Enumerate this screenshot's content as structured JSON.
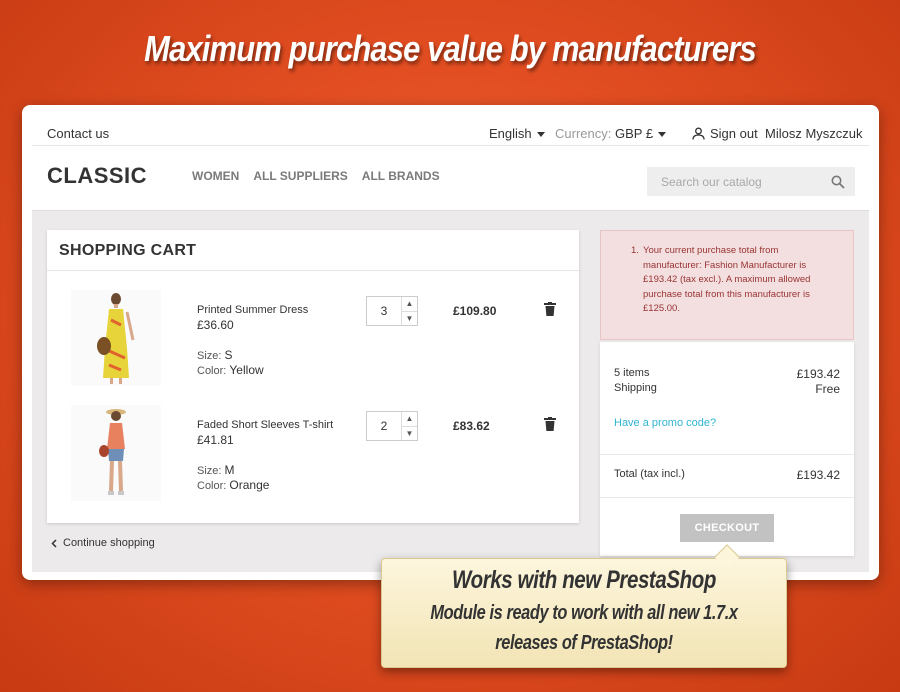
{
  "banner": {
    "title": "Maximum purchase value by manufacturers"
  },
  "topnav": {
    "contact": "Contact us",
    "language": "English",
    "currency_label": "Currency:",
    "currency_value": "GBP £",
    "sign_in": "Sign out",
    "user_name": "Milosz Myszczuk"
  },
  "header": {
    "logo": "CLASSIC",
    "nav": [
      "WOMEN",
      "ALL SUPPLIERS",
      "ALL BRANDS"
    ],
    "search_placeholder": "Search our catalog"
  },
  "cart": {
    "title": "SHOPPING CART",
    "items": [
      {
        "name": "Printed Summer Dress",
        "unit_price": "£36.60",
        "size_label": "Size:",
        "size": "S",
        "color_label": "Color:",
        "color": "Yellow",
        "qty": "3",
        "total": "£109.80"
      },
      {
        "name": "Faded Short Sleeves T-shirt",
        "unit_price": "£41.81",
        "size_label": "Size:",
        "size": "M",
        "color_label": "Color:",
        "color": "Orange",
        "qty": "2",
        "total": "£83.62"
      }
    ],
    "continue": "Continue shopping"
  },
  "alert": {
    "number": "1.",
    "message": "Your current purchase total from manufacturer: Fashion Manufacturer is £193.42 (tax excl.). A maximum allowed purchase total from this manufacturer is £125.00."
  },
  "summary": {
    "items_label": "5 items",
    "items_value": "£193.42",
    "shipping_label": "Shipping",
    "shipping_value": "Free",
    "promo": "Have a promo code?",
    "total_label": "Total (tax incl.)",
    "total_value": "£193.42",
    "checkout": "CHECKOUT"
  },
  "callout": {
    "title": "Works with new PrestaShop",
    "line1": "Module is ready to work with all new 1.7.x",
    "line2": "releases of PrestaShop!"
  },
  "colors": {
    "background": "#e24e22",
    "link": "#2fb5d2",
    "alert_bg": "#f3dfdf",
    "alert_text": "#9a3333"
  }
}
